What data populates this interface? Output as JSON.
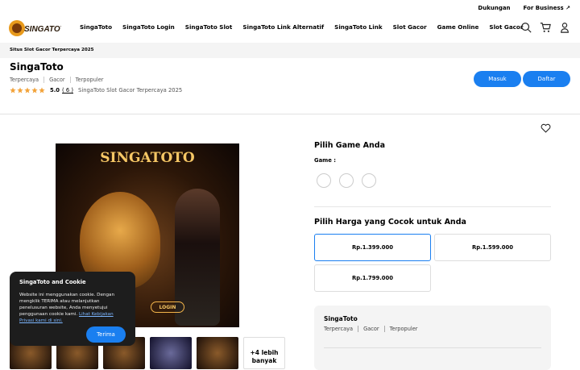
{
  "header": {
    "logo_text": "SINGATOTO",
    "top_links": [
      "Dukungan",
      "For Business ↗"
    ],
    "nav": [
      "SingaToto",
      "SingaToto Login",
      "SingaToto Slot",
      "SingaToto Link Alternatif",
      "SingaToto Link",
      "Slot Gacor",
      "Game Online",
      "Slot Gacor"
    ],
    "icons": [
      "search-icon",
      "cart-icon",
      "user-icon"
    ]
  },
  "breadcrumb": "Situs Slot Gacor Terpercaya 2025",
  "product": {
    "title": "SingaToto",
    "tags": [
      "Terpercaya",
      "Gacor",
      "Terpopuler"
    ],
    "rating": "5.0",
    "rating_count": "( 6 )",
    "rating_value": 5,
    "subtitle": "SingaToto Slot Gacor Terpercaya 2025",
    "btn_login": "Masuk",
    "btn_register": "Daftar"
  },
  "hero": {
    "brand": "SINGATOTO",
    "login_label": "LOGIN",
    "more_label": "+4 lebih banyak"
  },
  "game_section": {
    "title": "Pilih Game Anda",
    "game_label": "Game :"
  },
  "price_section": {
    "title": "Pilih Harga yang Cocok untuk Anda",
    "options": [
      "Rp.1.399.000",
      "Rp.1.599.000",
      "Rp.1.799.000"
    ],
    "selected_index": 0
  },
  "summary": {
    "title": "SingaToto",
    "tags": [
      "Terpercaya",
      "Gacor",
      "Terpopuler"
    ]
  },
  "cookie": {
    "title": "SingaToto and Cookie",
    "text": "Website ini menggunakan cookie. Dengan mengklik TERIMA atau melanjutkan penelusuran website, Anda menyetujui penggunaan cookie kami.",
    "link": "Lihat Kebijakan Privasi kami di sini.",
    "accept": "Terima"
  },
  "colors": {
    "accent": "#1a7ff0",
    "star": "#f2a33a",
    "cookie_bg": "#1d1d1d"
  }
}
